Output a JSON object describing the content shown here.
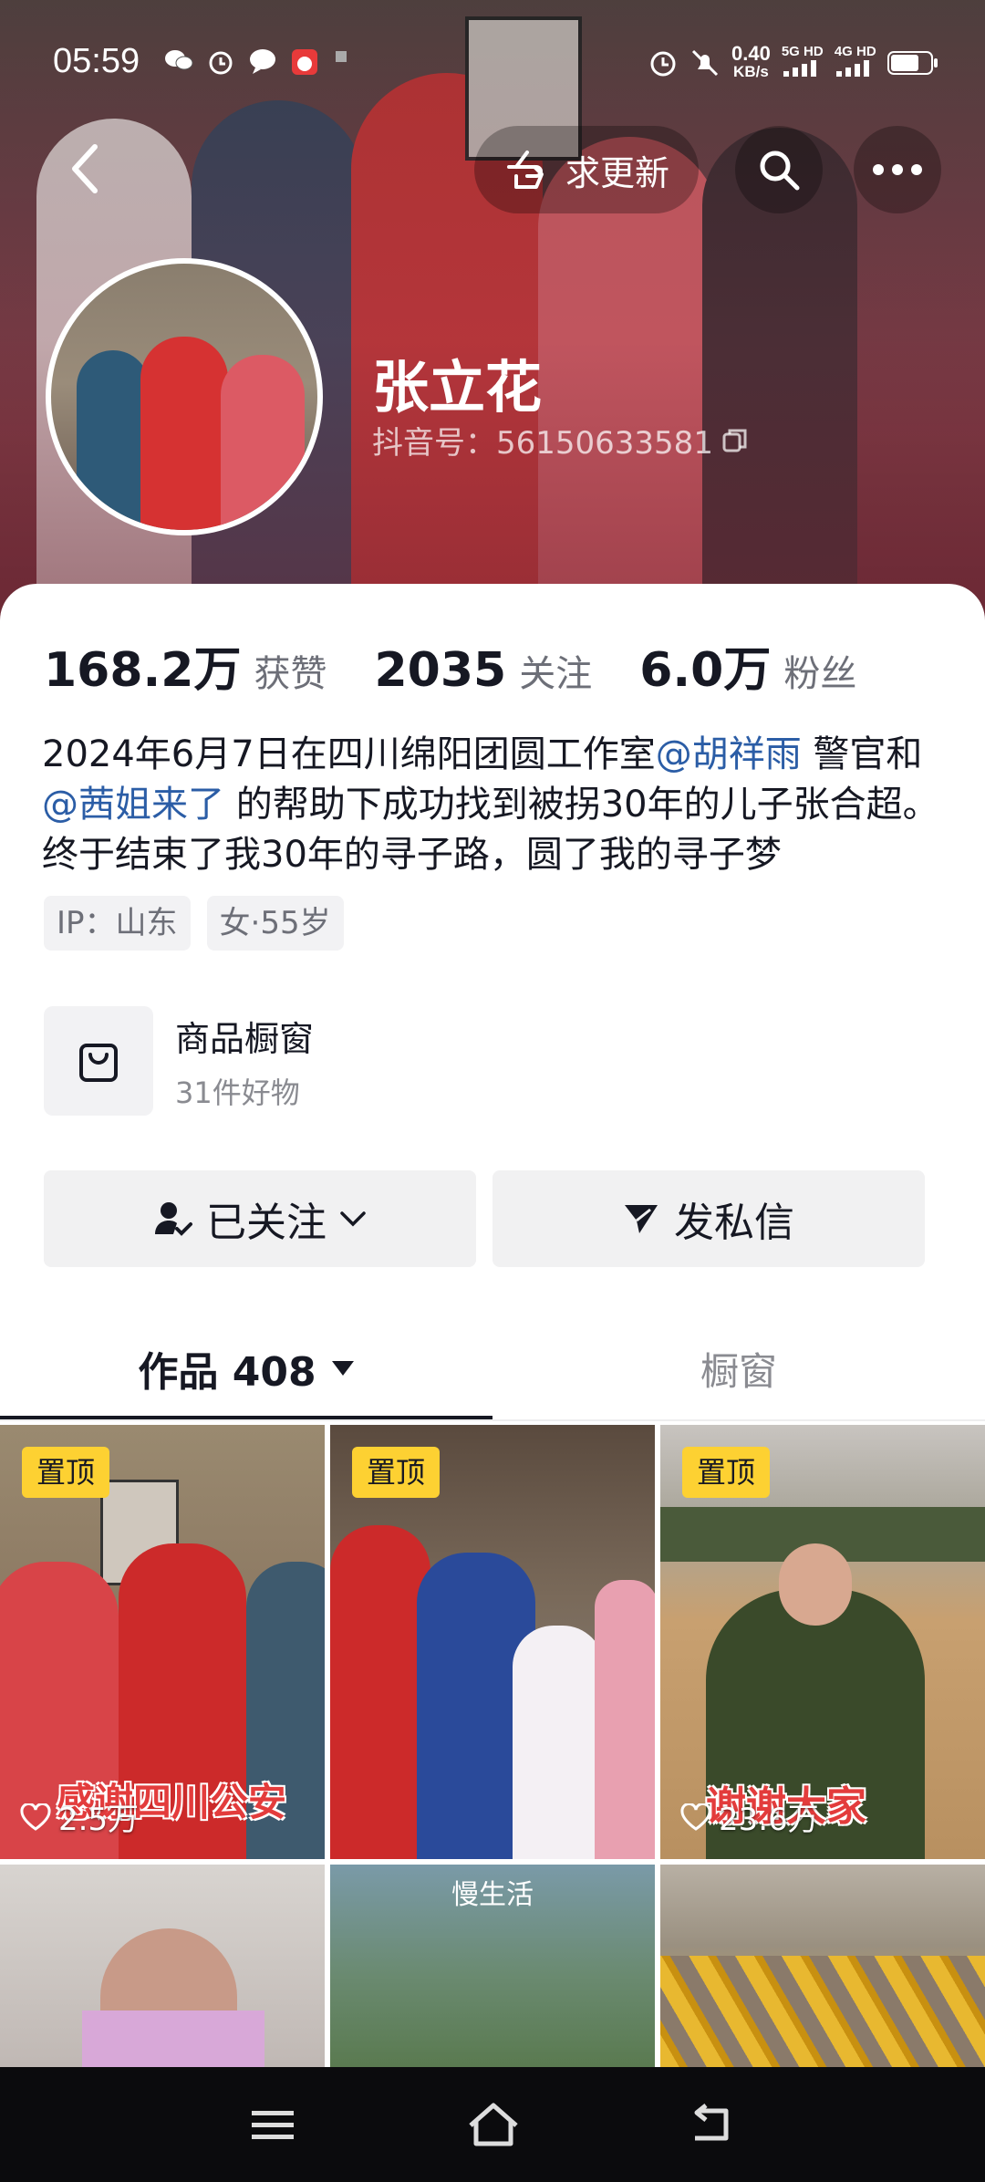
{
  "status_bar": {
    "time": "05:59",
    "speed_value": "0.40",
    "speed_unit": "KB/s",
    "sim1": "5G HD",
    "sim2": "4G HD"
  },
  "header": {
    "request_update_label": "求更新",
    "name": "张立花",
    "douyin_id": "抖音号：56150633581"
  },
  "stats": {
    "likes_value": "168.2万",
    "likes_label": "获赞",
    "following_value": "2035",
    "following_label": "关注",
    "fans_value": "6.0万",
    "fans_label": "粉丝"
  },
  "bio": {
    "part1": "2024年6月7日在四川绵阳团圆工作室",
    "mention1": "@胡祥雨",
    "part2": " 警官和",
    "mention2": "@茜姐来了",
    "part3": " 的帮助下成功找到被拐30年的儿子张合超。终于结束了我30年的寻子路，圆了我的寻子梦"
  },
  "tags": [
    "IP：山东",
    "女·55岁"
  ],
  "shop": {
    "title": "商品橱窗",
    "subtitle": "31件好物"
  },
  "actions": {
    "follow_label": "已关注",
    "message_label": "发私信"
  },
  "tabs": {
    "works_label": "作品 408",
    "window_label": "橱窗"
  },
  "grid": {
    "pinned_label": "置顶",
    "items": [
      {
        "likes": "2.5万",
        "overlay": "感谢四川公安"
      },
      {
        "likes": "",
        "overlay": ""
      },
      {
        "likes": "23.6万",
        "overlay": "谢谢大家"
      },
      {
        "likes": "",
        "overlay": ""
      },
      {
        "likes": "",
        "overlay": "慢生活"
      },
      {
        "likes": "",
        "overlay": ""
      }
    ]
  }
}
